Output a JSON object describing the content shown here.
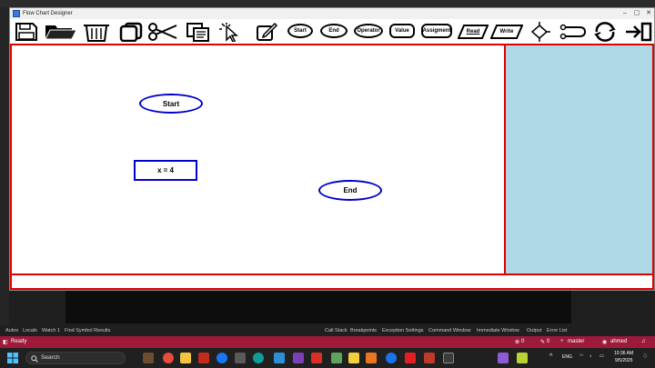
{
  "window": {
    "title": "Flow Chart Designer",
    "minimize": "–",
    "maximize": "▢",
    "close": "✕"
  },
  "toolbar": {
    "start_label": "Start",
    "end_label": "End",
    "operator_label": "Operator",
    "value_label": "Value",
    "assignment_label": "Assigment",
    "read_label": "Read",
    "write_label": "Write"
  },
  "canvas": {
    "start_text": "Start",
    "assignment_text": "x = 4",
    "end_text": "End"
  },
  "colors": {
    "border_red": "#e00000",
    "shape_blue": "#0000cc",
    "panel_blue": "#add8e6",
    "status_bar": "#9e1a3b"
  },
  "ide": {
    "output_tabs": [
      "Autos",
      "Locals",
      "Watch 1",
      "Find Symbol Results"
    ],
    "right_tabs": [
      "Call Stack",
      "Breakpoints",
      "Exception Settings",
      "Command Window",
      "Immediate Window",
      "Output",
      "Error List"
    ],
    "status": {
      "ready": "Ready",
      "errors": "0",
      "warnings": "0",
      "branch": "master",
      "user": "ahmed"
    }
  },
  "taskbar": {
    "search_placeholder": "Search",
    "language": "ENG",
    "time": "10:36 AM",
    "date": "9/5/2025"
  }
}
